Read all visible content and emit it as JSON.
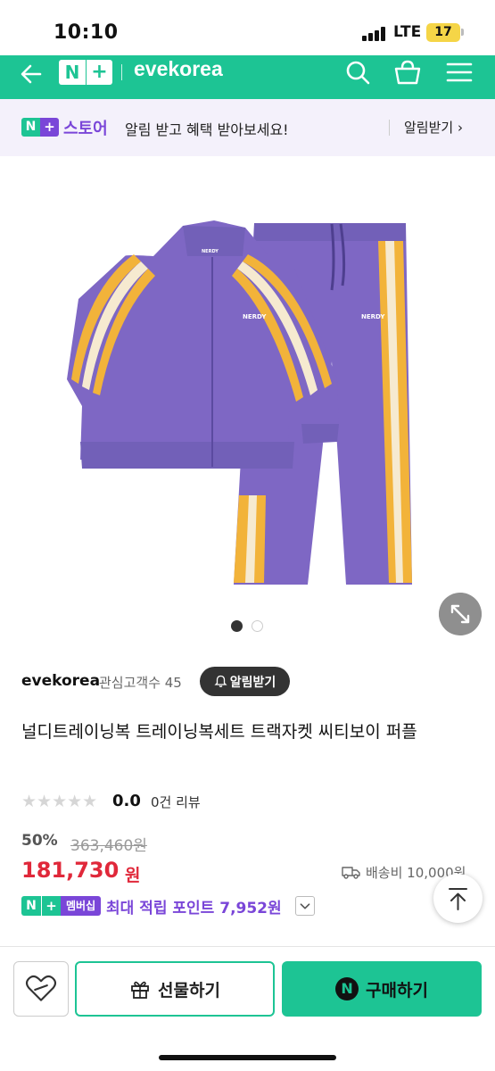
{
  "status_bar": {
    "time": "10:10",
    "network": "LTE",
    "battery": "17"
  },
  "header": {
    "logo_n": "N",
    "logo_plus": "+",
    "brand": "evekorea",
    "accent_color": "#1dc494"
  },
  "banner": {
    "logo_n": "N",
    "logo_plus": "+",
    "store": "스토어",
    "message": "알림 받고 혜택 받아보세요!",
    "action": "알림받기 ›"
  },
  "gallery": {
    "current_page": 1,
    "total_pages": 2
  },
  "seller": {
    "name": "evekorea",
    "followers": "관심고객수 45",
    "alarm_button": "알림받기"
  },
  "product": {
    "title": "널디트레이닝복 트레이닝복세트 트랙자켓 씨티보이 퍼플",
    "logo_text": "NERDY",
    "rating_stars": "★★★★★",
    "rating": "0.0",
    "reviews": "0건 리뷰",
    "discount": "50%",
    "original_price": "363,460원",
    "price": "181,730",
    "price_unit": "원",
    "shipping": "배송비 10,000원",
    "color_primary": "#7e67c4",
    "color_stripe": "#f2b33a"
  },
  "membership": {
    "badge_n": "N",
    "badge_plus": "+",
    "badge_label": "멤버십",
    "points_text": "최대 적립 포인트 7,952원"
  },
  "actions": {
    "gift": "선물하기",
    "buy": "구매하기",
    "buy_icon_letter": "N"
  }
}
